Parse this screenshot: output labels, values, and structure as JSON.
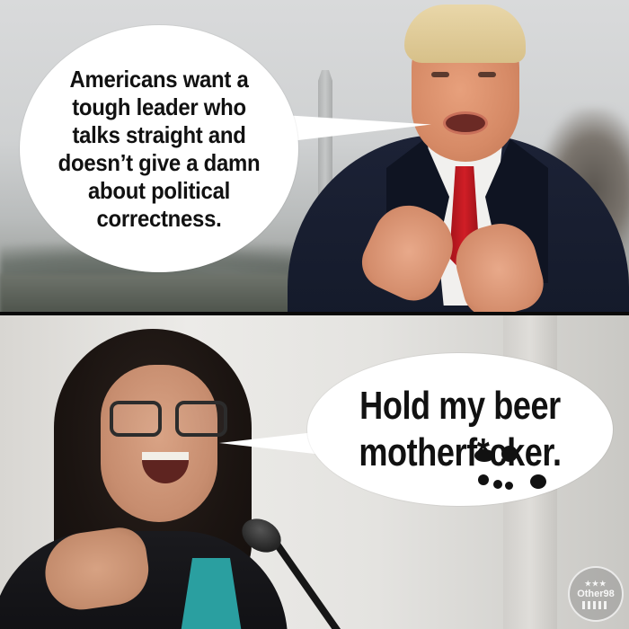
{
  "panels": {
    "top": {
      "speech": "Americans want a tough leader who talks straight and doesn’t give a damn about political correctness."
    },
    "bottom": {
      "speech_line1": "Hold my beer",
      "speech_line2": "motherf*cker."
    }
  },
  "watermark": {
    "text": "Other98",
    "stars": "★★★"
  },
  "colors": {
    "bubble": "#ffffff",
    "tie": "#d01e26",
    "coat": "#1c2236",
    "divider": "#0a0a0a"
  }
}
